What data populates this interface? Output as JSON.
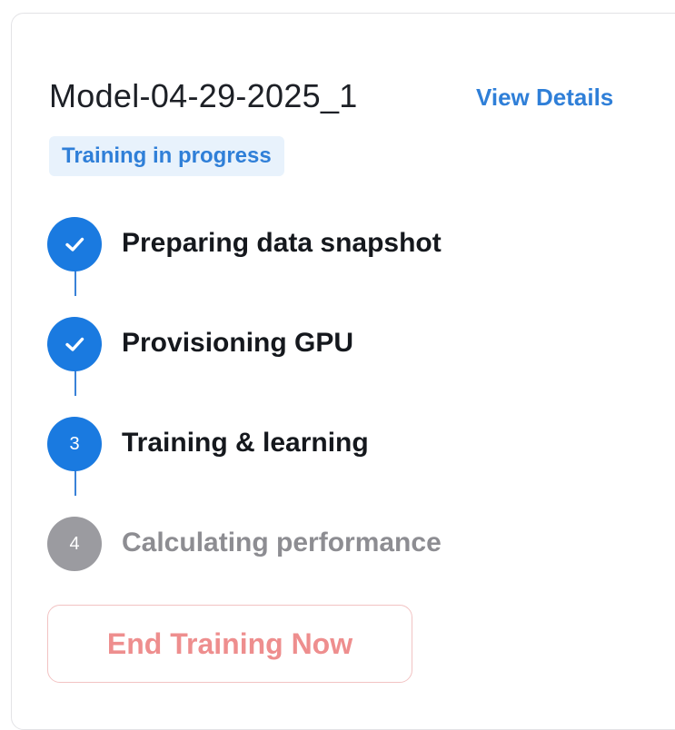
{
  "card": {
    "model_name": "Model-04-29-2025_1",
    "view_details_label": "View Details",
    "status_label": "Training in progress"
  },
  "steps": [
    {
      "number": "1",
      "label": "Preparing data snapshot",
      "state": "done",
      "icon": "checkmark-icon"
    },
    {
      "number": "2",
      "label": "Provisioning GPU",
      "state": "done",
      "icon": "checkmark-icon"
    },
    {
      "number": "3",
      "label": "Training & learning",
      "state": "active",
      "icon": "step-number"
    },
    {
      "number": "4",
      "label": "Calculating performance",
      "state": "pending",
      "icon": "step-number"
    }
  ],
  "actions": {
    "end_training_label": "End Training Now"
  },
  "colors": {
    "accent": "#1a7ae0",
    "link": "#2f7fd8",
    "pending": "#9b9ba0",
    "danger_text": "#ee8e8e",
    "danger_border": "#f2c3c3"
  }
}
